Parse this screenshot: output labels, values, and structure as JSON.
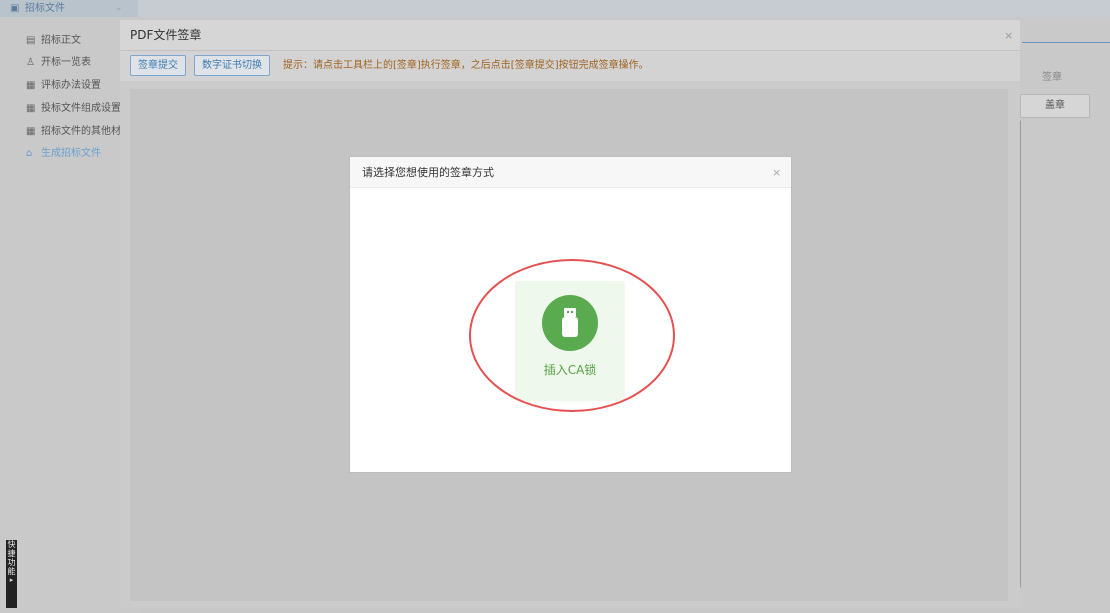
{
  "sidebar": {
    "header": {
      "icon": "document-icon",
      "label": "招标文件"
    },
    "items": [
      {
        "icon": "document-icon",
        "label": "招标正文"
      },
      {
        "icon": "people-icon",
        "label": "开标一览表"
      },
      {
        "icon": "grid-icon",
        "label": "评标办法设置"
      },
      {
        "icon": "grid-icon",
        "label": "投标文件组成设置"
      },
      {
        "icon": "grid-icon",
        "label": "招标文件的其他材料"
      },
      {
        "icon": "generate-icon",
        "label": "生成招标文件",
        "active": true
      }
    ],
    "quick_tab": "快捷功能"
  },
  "background_table": {
    "column_header": "签章",
    "cell_button": "盖章"
  },
  "pdf_panel": {
    "title": "PDF文件签章",
    "close_glyph": "×",
    "toolbar": {
      "submit_button": "签章提交",
      "switch_cert_button": "数字证书切换",
      "hint": "提示：请点击工具栏上的[签章]执行签章，之后点击[签章提交]按钮完成签章操作。"
    }
  },
  "dialog": {
    "title": "请选择您想使用的签章方式",
    "close_glyph": "×",
    "option": {
      "icon": "usb-key-icon",
      "label": "插入CA锁"
    }
  },
  "colors": {
    "accent_blue": "#3f7cb5",
    "ca_green": "#5aaa4f",
    "ca_bg": "#eff8ec",
    "highlight_red": "#e65050",
    "hint_orange": "#a0621f"
  }
}
